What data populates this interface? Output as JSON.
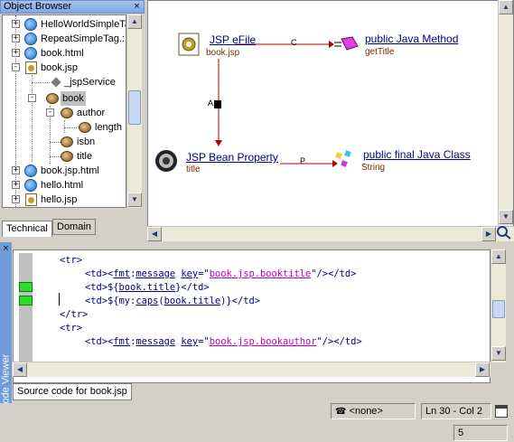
{
  "object_browser": {
    "title": "Object Browser",
    "close_glyph": "×",
    "tree": [
      {
        "label": "HelloWorldSimpleTa",
        "toggle": "+",
        "icon": "ie-icon"
      },
      {
        "label": "RepeatSimpleTag.:",
        "toggle": "+",
        "icon": "ie-icon"
      },
      {
        "label": "book.html",
        "toggle": "+",
        "icon": "ie-icon"
      },
      {
        "label": "book.jsp",
        "toggle": "-",
        "icon": "jsp-icon"
      },
      {
        "label": "_jspService",
        "icon": "diamond-icon"
      },
      {
        "label": "book",
        "toggle": "-",
        "icon": "bean-icon",
        "selected": true
      },
      {
        "label": "author",
        "toggle": "-",
        "icon": "bean-icon"
      },
      {
        "label": "length",
        "icon": "bean-icon"
      },
      {
        "label": "isbn",
        "icon": "bean-icon"
      },
      {
        "label": "title",
        "icon": "bean-icon"
      },
      {
        "label": "book.jsp.html",
        "toggle": "+",
        "icon": "ie-icon"
      },
      {
        "label": "hello.html",
        "toggle": "+",
        "icon": "ie-icon"
      },
      {
        "label": "hello.jsp",
        "toggle": "+",
        "icon": "jsp-icon"
      }
    ],
    "tabs": {
      "technical": "Technical",
      "domain": "Domain"
    }
  },
  "diagram": {
    "nodes": {
      "jsp_efile": {
        "label": "JSP eFile",
        "sub": "book.jsp",
        "icon": "jsp-file-icon"
      },
      "java_method": {
        "label": "public Java Method",
        "sub": "getTitle",
        "icon": "method-icon"
      },
      "bean_property": {
        "label": "JSP Bean Property",
        "sub": "title",
        "icon": "bean-property-icon"
      },
      "java_class": {
        "label": "public final Java Class",
        "sub": "String",
        "icon": "class-icon"
      }
    },
    "edges": {
      "c": "C",
      "a": "A",
      "p": "P"
    }
  },
  "code_viewer": {
    "side_label": "Code Viewer",
    "tab": "Source code for book.jsp"
  },
  "status": {
    "encoding": "<none>",
    "position": "Ln 30 - Col 2",
    "page": "5"
  },
  "colors": {
    "marker": "#2edb2e",
    "link": "#000080",
    "string": "#c000c0"
  }
}
